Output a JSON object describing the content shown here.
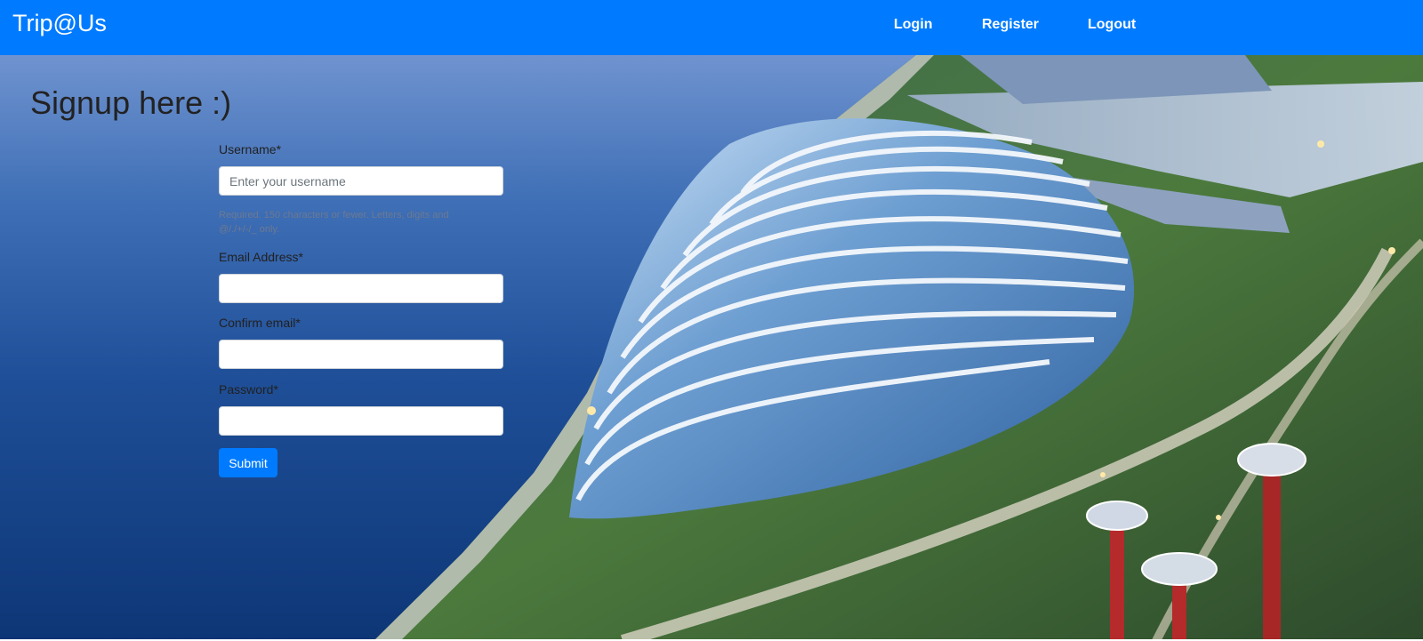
{
  "navbar": {
    "brand": "Trip@Us",
    "links": [
      "Login",
      "Register",
      "Logout"
    ]
  },
  "page": {
    "title": "Signup here :)"
  },
  "form": {
    "username": {
      "label": "Username*",
      "placeholder": "Enter your username",
      "value": "",
      "help": "Required. 150 characters or fewer. Letters, digits and @/./+/-/_ only."
    },
    "email": {
      "label": "Email Address*",
      "value": ""
    },
    "confirm_email": {
      "label": "Confirm email*",
      "value": ""
    },
    "password": {
      "label": "Password*",
      "value": ""
    },
    "submit_label": "Submit"
  },
  "colors": {
    "navbar": "#007bff",
    "button": "#007bff"
  }
}
